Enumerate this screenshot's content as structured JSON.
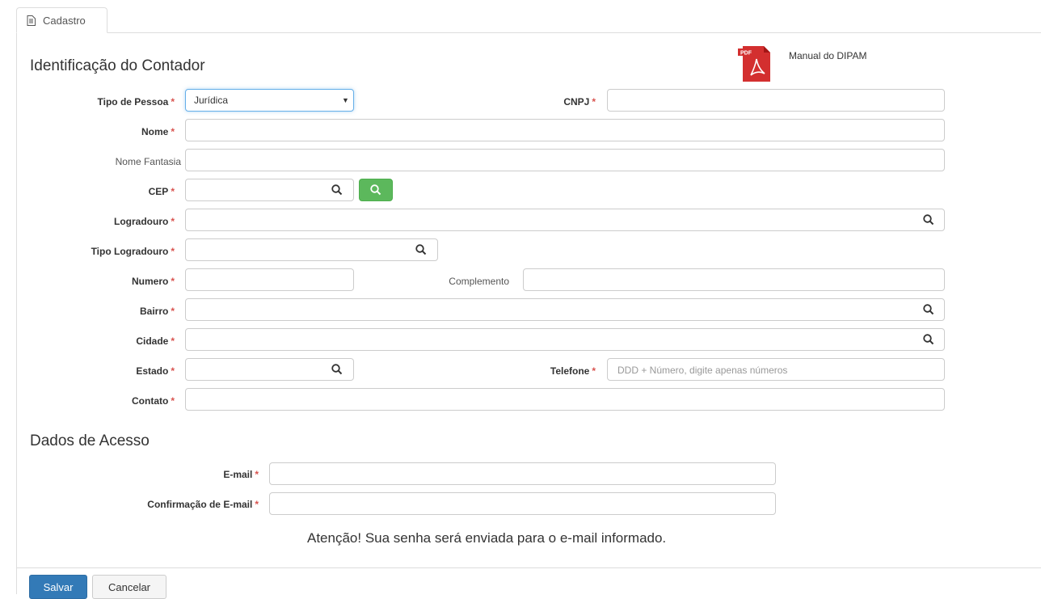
{
  "tab": {
    "label": "Cadastro",
    "icon": "document-icon"
  },
  "manual": {
    "label": "Manual do DIPAM",
    "icon": "pdf-icon",
    "icon_badge": "PDF"
  },
  "section1": {
    "title": "Identificação do Contador"
  },
  "form": {
    "tipo_pessoa": {
      "label": "Tipo de Pessoa",
      "required": "*",
      "value": "Jurídica"
    },
    "cnpj": {
      "label": "CNPJ",
      "required": "*",
      "value": ""
    },
    "nome": {
      "label": "Nome",
      "required": "*",
      "value": ""
    },
    "nome_fantasia": {
      "label": "Nome Fantasia",
      "value": ""
    },
    "cep": {
      "label": "CEP",
      "required": "*",
      "value": ""
    },
    "logradouro": {
      "label": "Logradouro",
      "required": "*",
      "value": ""
    },
    "tipo_logradouro": {
      "label": "Tipo Logradouro",
      "required": "*",
      "value": ""
    },
    "numero": {
      "label": "Numero",
      "required": "*",
      "value": ""
    },
    "complemento": {
      "label": "Complemento",
      "value": ""
    },
    "bairro": {
      "label": "Bairro",
      "required": "*",
      "value": ""
    },
    "cidade": {
      "label": "Cidade",
      "required": "*",
      "value": ""
    },
    "estado": {
      "label": "Estado",
      "required": "*",
      "value": ""
    },
    "telefone": {
      "label": "Telefone",
      "required": "*",
      "placeholder": "DDD + Número, digite apenas números",
      "value": ""
    },
    "contato": {
      "label": "Contato",
      "required": "*",
      "value": ""
    }
  },
  "section2": {
    "title": "Dados de Acesso"
  },
  "access": {
    "email": {
      "label": "E-mail",
      "required": "*",
      "value": ""
    },
    "email_confirm": {
      "label": "Confirmação de E-mail",
      "required": "*",
      "value": ""
    }
  },
  "notice": "Atenção! Sua senha será enviada para o e-mail informado.",
  "buttons": {
    "save": "Salvar",
    "cancel": "Cancelar"
  },
  "colors": {
    "primary": "#337ab7",
    "success": "#5cb85c",
    "required": "#d9534f",
    "pdf": "#d32f2f"
  }
}
